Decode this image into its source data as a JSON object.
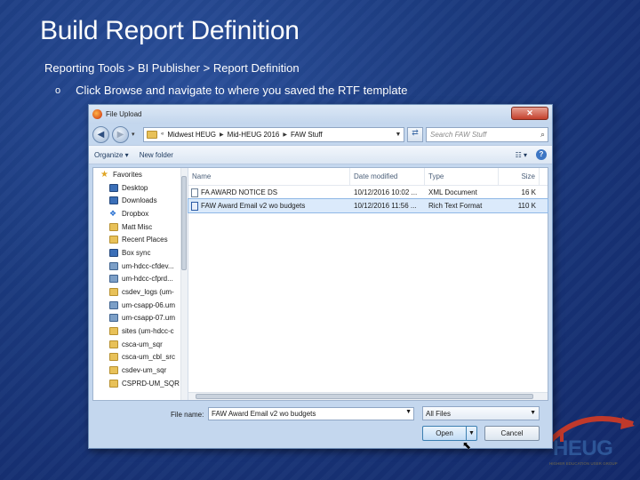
{
  "slide": {
    "title": "Build Report Definition",
    "breadcrumb": "Reporting Tools > BI Publisher > Report Definition",
    "bullet": "Click Browse and navigate to where you saved the RTF template"
  },
  "dialog": {
    "title": "File Upload",
    "close_label": "✕",
    "address": {
      "segments": [
        "Midwest HEUG",
        "Mid-HEUG 2016",
        "FAW Stuff"
      ]
    },
    "search_placeholder": "Search FAW Stuff",
    "toolbar": {
      "organize": "Organize ▾",
      "new_folder": "New folder",
      "views": "☷ ▾",
      "help": "?"
    },
    "nav_items": [
      {
        "label": "Favorites",
        "icon": "star-icon"
      },
      {
        "label": "Desktop",
        "icon": "desktop-icon"
      },
      {
        "label": "Downloads",
        "icon": "downloads-icon"
      },
      {
        "label": "Dropbox",
        "icon": "dropbox-icon"
      },
      {
        "label": "Matt Misc",
        "icon": "folder-icon"
      },
      {
        "label": "Recent Places",
        "icon": "recent-places-icon"
      },
      {
        "label": "Box sync",
        "icon": "box-sync-icon"
      },
      {
        "label": "um-hdcc-cfdev...",
        "icon": "network-drive-icon"
      },
      {
        "label": "um-hdcc-cfprd...",
        "icon": "network-drive-icon"
      },
      {
        "label": "csdev_logs (um-",
        "icon": "folder-icon"
      },
      {
        "label": "um-csapp-06.um",
        "icon": "network-drive-icon"
      },
      {
        "label": "um-csapp-07.um",
        "icon": "network-drive-icon"
      },
      {
        "label": "sites (um-hdcc-c",
        "icon": "folder-icon"
      },
      {
        "label": "csca-um_sqr",
        "icon": "folder-icon"
      },
      {
        "label": "csca-um_cbl_src",
        "icon": "folder-icon"
      },
      {
        "label": "csdev-um_sqr",
        "icon": "folder-icon"
      },
      {
        "label": "CSPRD-UM_SQR",
        "icon": "folder-icon"
      }
    ],
    "columns": {
      "name": "Name",
      "date": "Date modified",
      "type": "Type",
      "size": "Size"
    },
    "files": [
      {
        "name": "FA AWARD NOTICE DS",
        "date": "10/12/2016 10:02 ...",
        "type": "XML Document",
        "size": "16 K"
      },
      {
        "name": "FAW Award Email v2 wo budgets",
        "date": "10/12/2016 11:56 ...",
        "type": "Rich Text Format",
        "size": "110 K"
      }
    ],
    "filename_label": "File name:",
    "filename_value": "FAW Award Email v2 wo budgets",
    "filetype_value": "All Files",
    "open_label": "Open",
    "cancel_label": "Cancel"
  },
  "logo": {
    "word": "HEUG",
    "subtitle": "HIGHER EDUCATION USER GROUP",
    "brand_blue": "#2d5597",
    "brand_red": "#c0392b"
  }
}
